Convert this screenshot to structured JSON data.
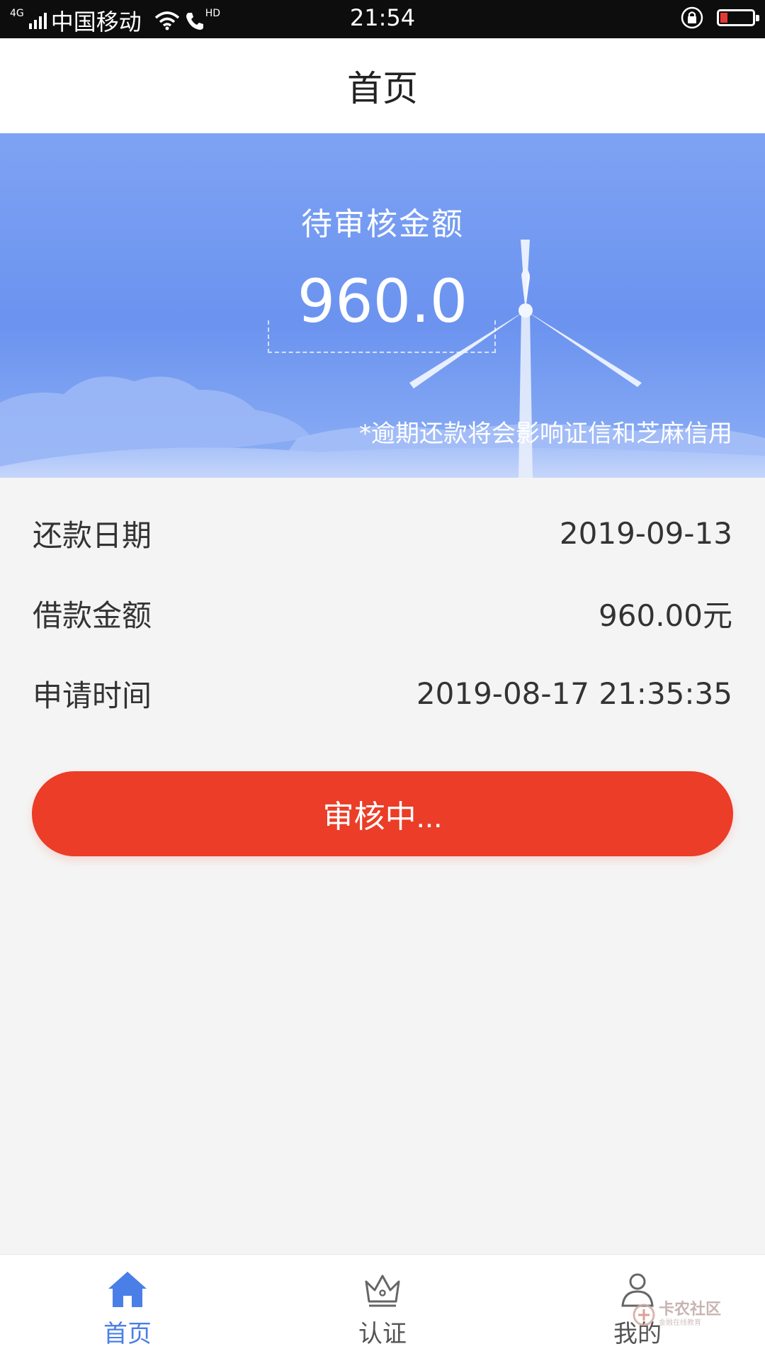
{
  "status_bar": {
    "network": "4G",
    "carrier": "中国移动",
    "hd": "HD",
    "time": "21:54"
  },
  "header": {
    "title": "首页"
  },
  "banner": {
    "label": "待审核金额",
    "amount": "960.0",
    "notice": "*逾期还款将会影响证信和芝麻信用"
  },
  "details": [
    {
      "label": "还款日期",
      "value": "2019-09-13"
    },
    {
      "label": "借款金额",
      "value": "960.00元"
    },
    {
      "label": "申请时间",
      "value": "2019-08-17 21:35:35"
    }
  ],
  "status_button": {
    "label": "审核中..."
  },
  "tabbar": {
    "items": [
      {
        "label": "首页",
        "icon": "home-icon",
        "active": true
      },
      {
        "label": "认证",
        "icon": "crown-icon",
        "active": false
      },
      {
        "label": "我的",
        "icon": "user-icon",
        "active": false
      }
    ]
  },
  "watermark": {
    "main": "卡农社区",
    "sub": "金融在线教育"
  },
  "colors": {
    "accent": "#4a7fe8",
    "button": "#eb3d27",
    "banner_top": "#7ea3f4",
    "banner_mid": "#6b93ef"
  }
}
